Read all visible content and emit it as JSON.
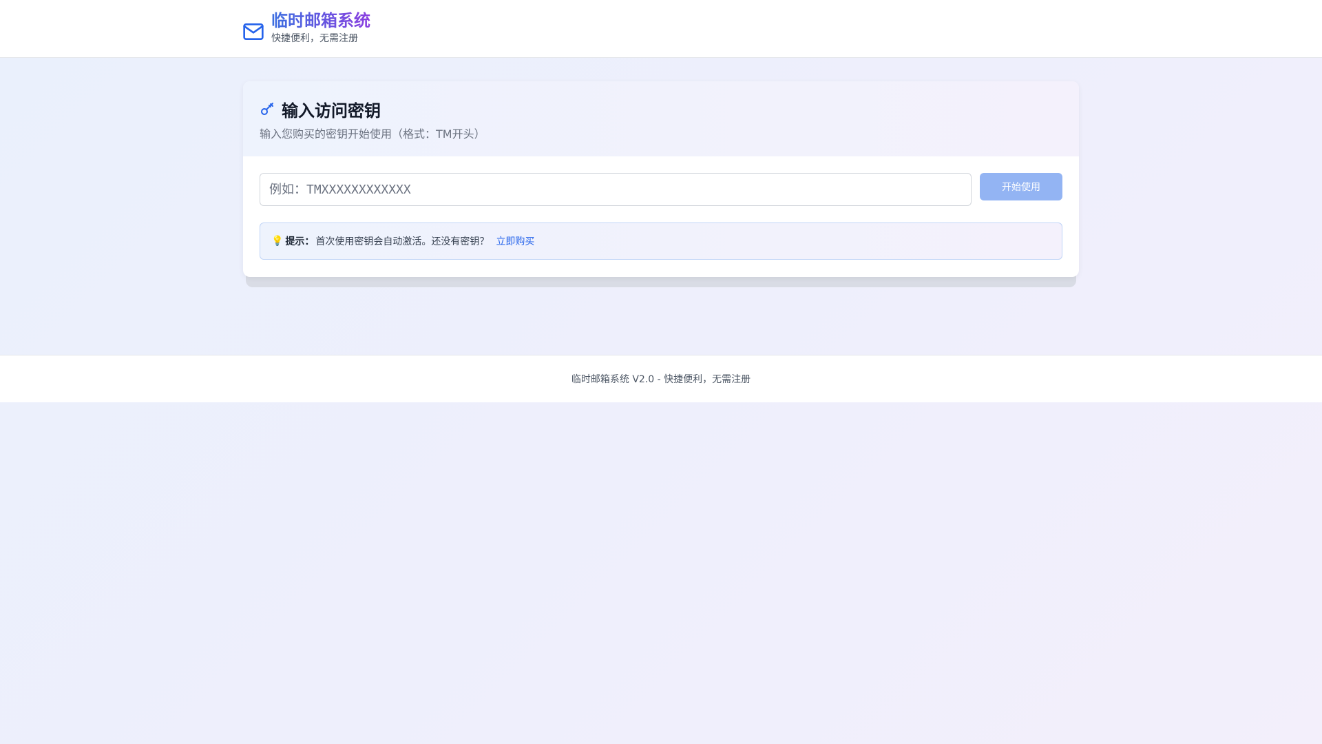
{
  "header": {
    "title": "临时邮箱系统",
    "subtitle": "快捷便利，无需注册",
    "icon": "mail-icon"
  },
  "card": {
    "icon": "key-icon",
    "title": "输入访问密钥",
    "description": "输入您购买的密钥开始使用（格式：TM开头）",
    "input": {
      "value": "",
      "placeholder": "例如：TMXXXXXXXXXXXX"
    },
    "button_label": "开始使用",
    "tip": {
      "icon": "💡",
      "label": "提示：",
      "text": "首次使用密钥会自动激活。还没有密钥？",
      "link": "立即购买"
    }
  },
  "footer": {
    "text": "临时邮箱系统 V2.0 - 快捷便利，无需注册"
  },
  "colors": {
    "accent": "#2563eb",
    "button_disabled": "#93b4f3",
    "title_gradient_start": "#3b6fe0",
    "title_gradient_end": "#8b3fe0"
  }
}
